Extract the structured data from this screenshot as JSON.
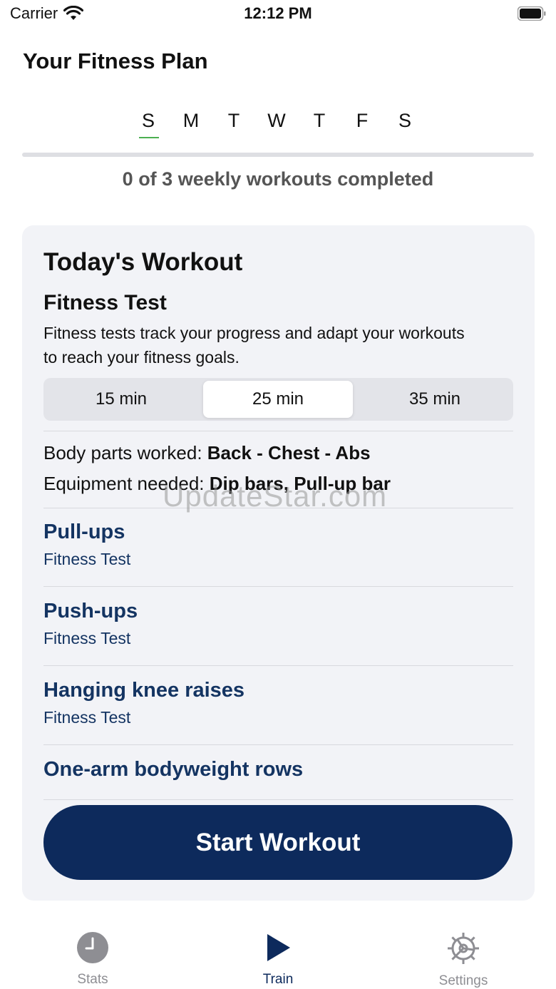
{
  "status_bar": {
    "carrier": "Carrier",
    "time": "12:12 PM"
  },
  "page": {
    "title": "Your Fitness Plan"
  },
  "week": {
    "days": [
      "S",
      "M",
      "T",
      "W",
      "T",
      "F",
      "S"
    ],
    "active_index": 0,
    "progress_fraction": 0,
    "progress_text": "0 of 3 weekly workouts completed"
  },
  "workout": {
    "heading": "Today's Workout",
    "test_title": "Fitness Test",
    "description": "Fitness tests track your progress and adapt your workouts to reach your fitness goals.",
    "durations": [
      "15 min",
      "25 min",
      "35 min"
    ],
    "selected_duration": "25 min",
    "body_parts_label": "Body parts worked: ",
    "body_parts_value": "Back - Chest - Abs",
    "equipment_label": "Equipment needed: ",
    "equipment_value": "Dip bars, Pull-up bar",
    "exercises": [
      {
        "name": "Pull-ups",
        "sub": "Fitness Test"
      },
      {
        "name": "Push-ups",
        "sub": "Fitness Test"
      },
      {
        "name": "Hanging knee raises",
        "sub": "Fitness Test"
      },
      {
        "name": "One-arm bodyweight rows",
        "sub": ""
      }
    ],
    "start_label": "Start Workout"
  },
  "watermark": "UpdateStar.com",
  "tabs": [
    {
      "label": "Stats",
      "icon": "clock-icon"
    },
    {
      "label": "Train",
      "icon": "play-icon"
    },
    {
      "label": "Settings",
      "icon": "gear-icon"
    }
  ],
  "colors": {
    "accent": "#0d2a5c",
    "link": "#143462",
    "progress": "#4caf50",
    "card": "#f2f3f7"
  }
}
